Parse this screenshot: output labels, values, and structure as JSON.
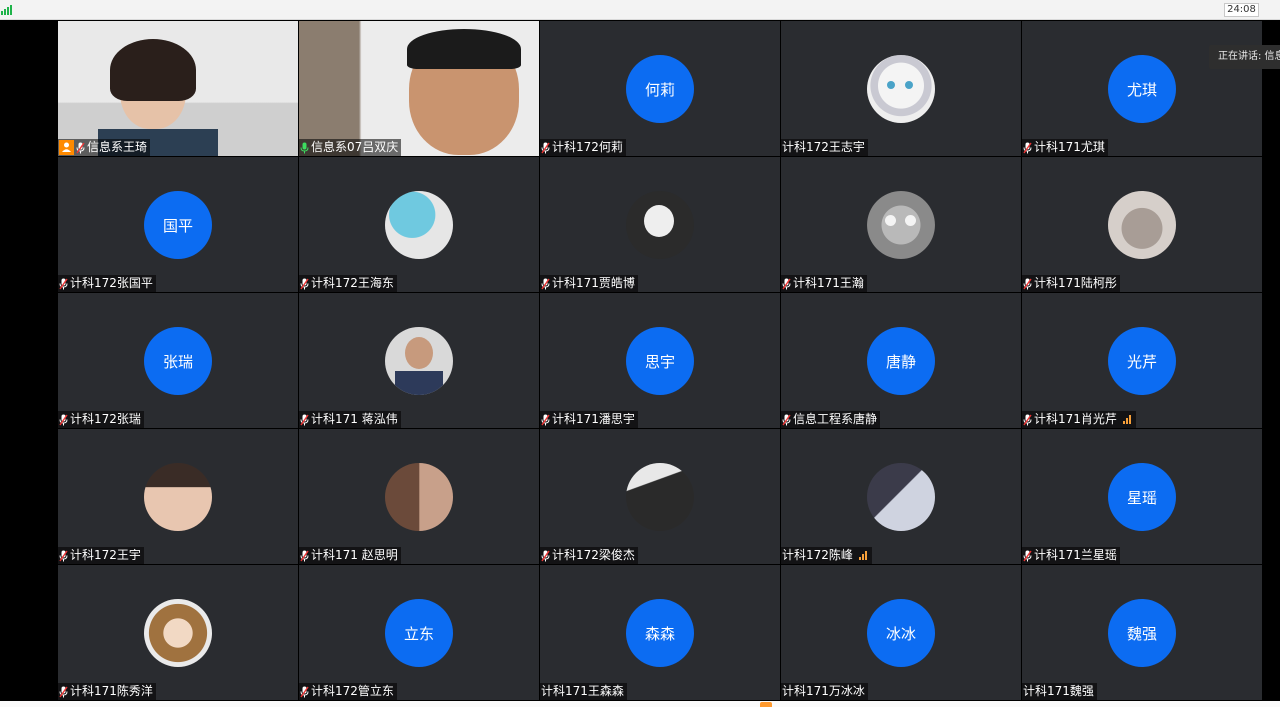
{
  "topbar": {
    "timer": "24:08"
  },
  "speaking_indicator": "正在讲话: 信息系",
  "colors": {
    "avatar_blue": "#0c6cf2",
    "active_border": "#39c05a",
    "host_orange": "#ff8a00"
  },
  "tiles": [
    {
      "name": "信息系王琦",
      "type": "video",
      "host": true,
      "mic": "muted"
    },
    {
      "name": "信息系07吕双庆",
      "type": "video",
      "mic": "active",
      "active": true
    },
    {
      "name": "计科172何莉",
      "type": "letter",
      "initials": "何莉",
      "mic": "muted"
    },
    {
      "name": "计科172王志宇",
      "type": "image",
      "image": "anime-cat-girl",
      "mic": "none"
    },
    {
      "name": "计科171尤琪",
      "type": "letter",
      "initials": "尤琪",
      "mic": "muted"
    },
    {
      "name": "计科172张国平",
      "type": "letter",
      "initials": "国平",
      "mic": "muted"
    },
    {
      "name": "计科172王海东",
      "type": "image",
      "image": "penguin-mask",
      "mic": "muted"
    },
    {
      "name": "计科171贾皓博",
      "type": "image",
      "image": "chibi-sketch",
      "mic": "muted"
    },
    {
      "name": "计科171王瀚",
      "type": "image",
      "image": "gray-cat",
      "mic": "muted"
    },
    {
      "name": "计科171陆柯彤",
      "type": "image",
      "image": "sleeping-cat",
      "mic": "muted"
    },
    {
      "name": "计科172张瑞",
      "type": "letter",
      "initials": "张瑞",
      "mic": "muted"
    },
    {
      "name": "计科171 蒋泓伟",
      "type": "image",
      "image": "man-portrait",
      "mic": "muted"
    },
    {
      "name": "计科171潘思宇",
      "type": "letter",
      "initials": "思宇",
      "mic": "muted"
    },
    {
      "name": "信息工程系唐静",
      "type": "letter",
      "initials": "唐静",
      "mic": "muted"
    },
    {
      "name": "计科171肖光芹",
      "type": "letter",
      "initials": "光芹",
      "mic": "muted",
      "signal": true
    },
    {
      "name": "计科172王宇",
      "type": "image",
      "image": "selfie",
      "mic": "muted"
    },
    {
      "name": "计科171 赵思明",
      "type": "image",
      "image": "drama-couple",
      "mic": "muted"
    },
    {
      "name": "计科172梁俊杰",
      "type": "image",
      "image": "dark-portrait",
      "mic": "muted"
    },
    {
      "name": "计科172陈峰",
      "type": "image",
      "image": "anime-dark",
      "mic": "none",
      "signal": true
    },
    {
      "name": "计科171兰星瑶",
      "type": "letter",
      "initials": "星瑶",
      "mic": "muted"
    },
    {
      "name": "计科171陈秀洋",
      "type": "image",
      "image": "anime-girl",
      "mic": "muted"
    },
    {
      "name": "计科172管立东",
      "type": "letter",
      "initials": "立东",
      "mic": "muted"
    },
    {
      "name": "计科171王森森",
      "type": "letter",
      "initials": "森森",
      "mic": "none"
    },
    {
      "name": "计科171万冰冰",
      "type": "letter",
      "initials": "冰冰",
      "mic": "none"
    },
    {
      "name": "计科171魏强",
      "type": "letter",
      "initials": "魏强",
      "mic": "none"
    }
  ]
}
